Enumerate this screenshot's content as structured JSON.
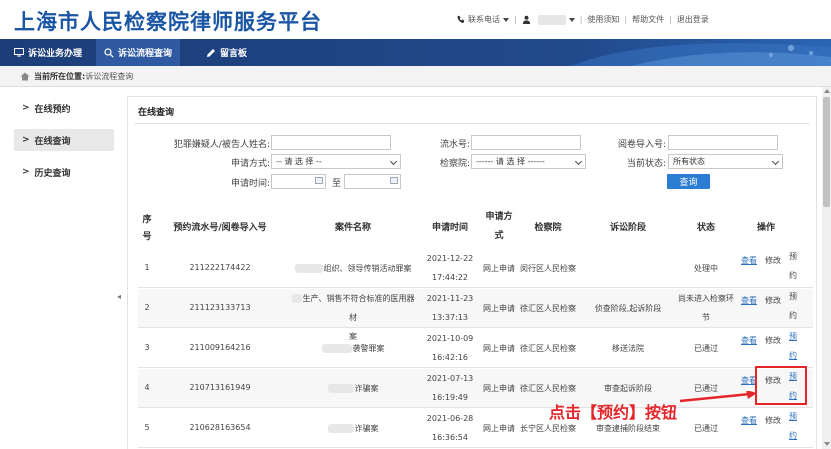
{
  "header": {
    "title": "上海市人民检察院律师服务平台",
    "contact_label": "联系电话",
    "user_name": "",
    "links": [
      "使用须知",
      "帮助文件",
      "退出登录"
    ]
  },
  "nav": {
    "items": [
      {
        "label": "诉讼业务办理",
        "icon": "monitor-icon",
        "active": false
      },
      {
        "label": "诉讼流程查询",
        "icon": "search-icon",
        "active": true
      },
      {
        "label": "留言板",
        "icon": "pencil-icon",
        "active": false
      }
    ]
  },
  "breadcrumb": {
    "label": "当前所在位置:",
    "value": "诉讼流程查询"
  },
  "sidebar": {
    "items": [
      {
        "label": "在线预约",
        "active": false
      },
      {
        "label": "在线查询",
        "active": true
      },
      {
        "label": "历史查询",
        "active": false
      }
    ]
  },
  "panel": {
    "title": "在线查询"
  },
  "form": {
    "suspect_label": "犯罪嫌疑人/被告人姓名:",
    "serial_label": "流水号:",
    "file_import_label": "阅卷导入号:",
    "method_label": "申请方式:",
    "method_value": "-- 请 选 择 --",
    "procuratorate_label": "检察院:",
    "procuratorate_value": "------ 请 选 择 ------",
    "status_label": "当前状态:",
    "status_value": "所有状态",
    "time_label": "申请时间:",
    "to_label": "至",
    "search_button": "查询"
  },
  "table": {
    "headers": {
      "seq_line1": "序",
      "seq_line2": "号",
      "serial": "预约流水号/阅卷导入号",
      "case": "案件名称",
      "time": "申请时间",
      "method_line1": "申请方",
      "method_line2": "式",
      "procuratorate": "检察院",
      "stage": "诉讼阶段",
      "status": "状态",
      "ops": "操作"
    },
    "ops": {
      "view": "查看",
      "edit": "修改",
      "book_1": "预",
      "book_2": "约"
    },
    "rows": [
      {
        "seq": "1",
        "serial": "211222174422",
        "case_line1": "组织、领导传销活动罪案",
        "case_line2": "",
        "date": "2021-12-22",
        "time": "17:44:22",
        "method": "网上申请",
        "procuratorate": "闵行区人民检察",
        "stage": "",
        "status_line1": "处理中",
        "status_line2": "",
        "book_link": false
      },
      {
        "seq": "2",
        "serial": "211123133713",
        "case_line1": "生产、销售不符合标准的医用器材",
        "case_line2": "案",
        "date": "2021-11-23",
        "time": "13:37:13",
        "method": "网上申请",
        "procuratorate": "徐汇区人民检察",
        "stage": "侦查阶段,起诉阶段",
        "status_line1": "尚未进入检察环",
        "status_line2": "节",
        "book_link": false
      },
      {
        "seq": "3",
        "serial": "211009164216",
        "case_line1": "袭警罪案",
        "case_line2": "",
        "date": "2021-10-09",
        "time": "16:42:16",
        "method": "网上申请",
        "procuratorate": "徐汇区人民检察",
        "stage": "移送法院",
        "status_line1": "已通过",
        "status_line2": "",
        "book_link": true
      },
      {
        "seq": "4",
        "serial": "210713161949",
        "case_line1": "诈骗案",
        "case_line2": "",
        "date": "2021-07-13",
        "time": "16:19:49",
        "method": "网上申请",
        "procuratorate": "徐汇区人民检察",
        "stage": "审查起诉阶段",
        "status_line1": "已通过",
        "status_line2": "",
        "book_link": true
      },
      {
        "seq": "5",
        "serial": "210628163654",
        "case_line1": "诈骗案",
        "case_line2": "",
        "date": "2021-06-28",
        "time": "16:36:54",
        "method": "网上申请",
        "procuratorate": "长宁区人民检察",
        "stage": "审查逮捕阶段结束",
        "status_line1": "已通过",
        "status_line2": "",
        "book_link": true
      }
    ]
  },
  "annotation": {
    "text": "点击【预约】按钮",
    "color": "#e3262a"
  },
  "colors": {
    "title": "#1b56a5",
    "nav_bg": "#214a8c",
    "link": "#2b6fc2",
    "button": "#2b7cd3"
  }
}
